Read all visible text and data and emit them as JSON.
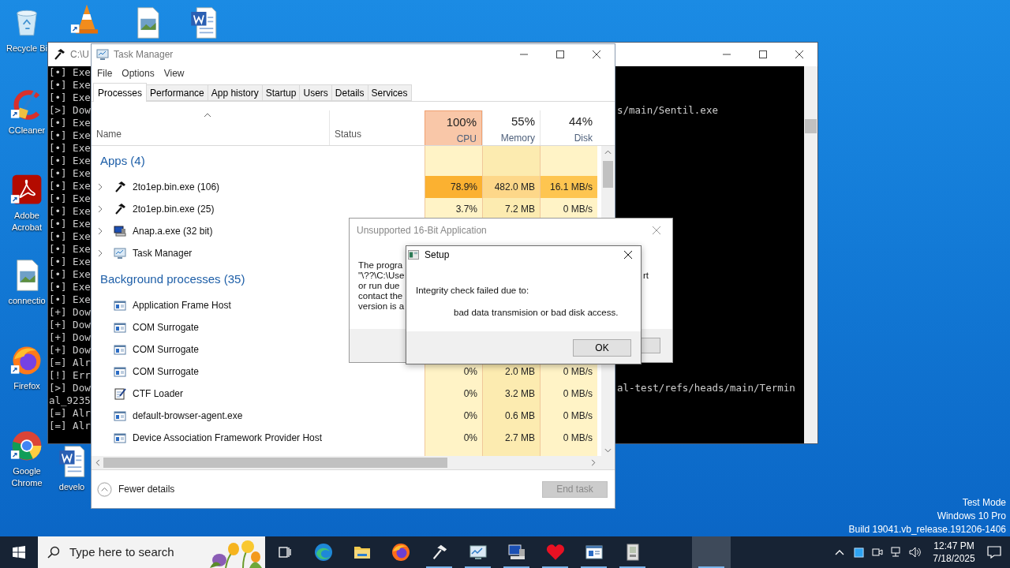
{
  "desktop_icons": [
    {
      "kind": "recycle-bin",
      "label": "Recycle Bi",
      "shortcut": false
    },
    {
      "kind": "cone",
      "shortcut": true
    },
    {
      "kind": "image-file",
      "shortcut": false
    },
    {
      "kind": "word-document",
      "shortcut": false
    },
    {
      "kind": "broom",
      "label": "CCleaner",
      "shortcut": true
    },
    {
      "kind": "pdf",
      "label": "Adobe Acrobat",
      "shortcut": true
    },
    {
      "kind": "image-file",
      "label": "connectio",
      "shortcut": false
    },
    {
      "kind": "firefox",
      "label": "Firefox",
      "shortcut": true
    },
    {
      "kind": "chrome",
      "label": "Google Chrome",
      "shortcut": true
    },
    {
      "kind": "word-document",
      "label": "develo",
      "shortcut": false
    }
  ],
  "console": {
    "title": "C:\\U",
    "lines": [
      {
        "text": "[•] Exe"
      },
      {
        "text": "[•] Exe"
      },
      {
        "text": "[•] Exe"
      },
      {
        "text": "[>] Dow",
        "tail": "s/main/Sentil.exe"
      },
      {
        "text": "[•] Exe"
      },
      {
        "text": "[•] Exe"
      },
      {
        "text": "[•] Exe"
      },
      {
        "text": "[•] Exe"
      },
      {
        "text": "[•] Exe"
      },
      {
        "text": "[•] Exe"
      },
      {
        "text": "[•] Exe"
      },
      {
        "text": "[•] Exe"
      },
      {
        "text": "[•] Exe"
      },
      {
        "text": "[•] Exe"
      },
      {
        "text": "[•] Exe"
      },
      {
        "text": "[•] Exe"
      },
      {
        "text": "[•] Exe"
      },
      {
        "text": "[•] Exe"
      },
      {
        "text": "[•] Exe"
      },
      {
        "text": "[+] Dow"
      },
      {
        "text": "[+] Dow"
      },
      {
        "text": "[+] Dow"
      },
      {
        "text": "[+] Dow"
      },
      {
        "text": "[=] Alr"
      },
      {
        "text": "[!] Err"
      },
      {
        "text": "[>] Dow",
        "tail": "al-test/refs/heads/main/Termin"
      },
      {
        "text": "al_9235"
      },
      {
        "text": "[=] Alr"
      },
      {
        "text": "[=] Alr"
      }
    ]
  },
  "task_manager": {
    "title": "Task Manager",
    "menu": [
      "File",
      "Options",
      "View"
    ],
    "tabs": [
      {
        "label": "Processes",
        "selected": true
      },
      {
        "label": "Performance",
        "selected": false
      },
      {
        "label": "App history",
        "selected": false
      },
      {
        "label": "Startup",
        "selected": false
      },
      {
        "label": "Users",
        "selected": false
      },
      {
        "label": "Details",
        "selected": false
      },
      {
        "label": "Services",
        "selected": false
      }
    ],
    "columns": [
      {
        "label": "Name",
        "sorted": true
      },
      {
        "label": "Status",
        "sorted": false
      },
      {
        "label": "CPU",
        "usage": "100%",
        "highlighted": true,
        "sorted": false
      },
      {
        "label": "Memory",
        "usage": "55%",
        "highlighted": false,
        "sorted": false
      },
      {
        "label": "Disk",
        "usage": "44%",
        "highlighted": false,
        "sorted": false
      }
    ],
    "groups": [
      {
        "title": "Apps (4)",
        "rows": [
          {
            "name": "2to1ep.bin.exe (106)",
            "kind": "hammer",
            "expandable": true,
            "hot": true,
            "cpu": "78.9%",
            "memory": "482.0 MB",
            "disk": "16.1 MB/s"
          },
          {
            "name": "2to1ep.bin.exe (25)",
            "kind": "hammer",
            "expandable": true,
            "hot": false,
            "cpu": "3.7%",
            "memory": "7.2 MB",
            "disk": "0 MB/s"
          },
          {
            "name": "Anap.a.exe (32 bit)",
            "kind": "computer",
            "expandable": true
          },
          {
            "name": "Task Manager",
            "kind": "monitor",
            "expandable": true
          }
        ]
      },
      {
        "title": "Background processes (35)",
        "rows": [
          {
            "name": "Application Frame Host",
            "kind": "window",
            "expandable": false
          },
          {
            "name": "COM Surrogate",
            "kind": "window",
            "expandable": false
          },
          {
            "name": "COM Surrogate",
            "kind": "window",
            "expandable": false
          },
          {
            "name": "COM Surrogate",
            "kind": "window",
            "expandable": false,
            "hot": false,
            "cpu": "0%",
            "memory": "2.0 MB",
            "disk": "0 MB/s"
          },
          {
            "name": "CTF Loader",
            "kind": "notepad",
            "expandable": false,
            "hot": false,
            "cpu": "0%",
            "memory": "3.2 MB",
            "disk": "0 MB/s"
          },
          {
            "name": "default-browser-agent.exe",
            "kind": "window",
            "expandable": false,
            "hot": false,
            "cpu": "0%",
            "memory": "0.6 MB",
            "disk": "0 MB/s"
          },
          {
            "name": "Device Association Framework Provider Host",
            "kind": "window",
            "expandable": false,
            "hot": false,
            "cpu": "0%",
            "memory": "2.7 MB",
            "disk": "0 MB/s"
          }
        ]
      }
    ],
    "footer": {
      "toggle": "Fewer details",
      "end_task": {
        "label": "End task",
        "disabled": true
      }
    }
  },
  "unsupported_dialog": {
    "title": "Unsupported 16-Bit Application",
    "body_lines": [
      {
        "text": "The progra"
      },
      {
        "text": "\"\\??\\C:\\Use",
        "tail": "rt"
      },
      {
        "text": "or run due"
      },
      {
        "text": "contact the"
      },
      {
        "text": "version is a"
      }
    ]
  },
  "setup_dialog": {
    "title": "Setup",
    "message": "Integrity check failed due to:",
    "detail": "bad data transmision or bad disk access.",
    "button": "OK"
  },
  "system_info": [
    "Test Mode",
    "Windows 10 Pro",
    "Build 19041.vb_release.191206-1406"
  ],
  "taskbar": {
    "search_placeholder": "Type here to search",
    "apps": [
      {
        "kind": "task-view",
        "running": false,
        "selected": false
      },
      {
        "kind": "edge",
        "running": false,
        "selected": false
      },
      {
        "kind": "folder",
        "running": false,
        "selected": false
      },
      {
        "kind": "firefox",
        "running": false,
        "selected": false
      },
      {
        "kind": "hammer",
        "running": true,
        "selected": false
      },
      {
        "kind": "monitor",
        "running": true,
        "selected": false
      },
      {
        "kind": "computer",
        "running": true,
        "selected": false
      },
      {
        "kind": "heart",
        "running": true,
        "selected": false
      },
      {
        "kind": "window",
        "running": true,
        "selected": false
      },
      {
        "kind": "installer",
        "running": true,
        "selected": false
      },
      {
        "kind": "blank",
        "running": true,
        "selected": true
      }
    ],
    "tray": [
      {
        "kind": "chevron"
      },
      {
        "kind": "square"
      },
      {
        "kind": "meeting"
      },
      {
        "kind": "network"
      },
      {
        "kind": "volume"
      }
    ],
    "time": "12:47 PM",
    "date": "7/18/2025"
  }
}
